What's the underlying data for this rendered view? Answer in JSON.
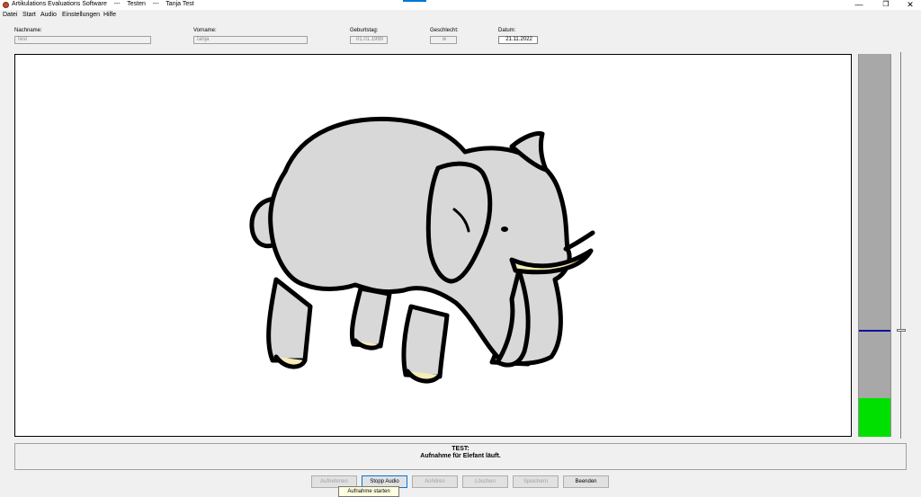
{
  "window": {
    "title": "Artikulations Evaluations Software    ---    Testen    ---    Tanja Test",
    "minimize_glyph": "—",
    "maximize_glyph": "❐",
    "close_glyph": "✕"
  },
  "menu": [
    "Datei",
    "Start",
    "Audio",
    "Einstellungen",
    "Hilfe"
  ],
  "fields": {
    "nachname": {
      "label": "Nachname:",
      "value": "Test"
    },
    "vorname": {
      "label": "Vorname:",
      "value": "Tanja"
    },
    "geburtstag": {
      "label": "Geburtstag:",
      "value": "01.01.1999"
    },
    "geschlecht": {
      "label": "Geschlecht:",
      "value": "w"
    },
    "datum": {
      "label": "Datum:",
      "value": "21.11.2022"
    }
  },
  "canvas": {
    "picture_icon": "elephant-illustration"
  },
  "meter": {
    "level_fraction": 0.1,
    "threshold_fraction": 0.28,
    "level_color": "#00e000",
    "threshold_color": "#1010a0"
  },
  "status": {
    "title": "TEST:",
    "message": "Aufnahme für Elefant läuft."
  },
  "buttons": {
    "aufnehmen": "Aufnehmen",
    "stopp_audio": "Stopp Audio",
    "anhoeren": "Anhören",
    "loeschen": "Löschen",
    "speichern": "Speichern",
    "beenden": "Beenden"
  },
  "tooltip": "Aufnahme starten"
}
